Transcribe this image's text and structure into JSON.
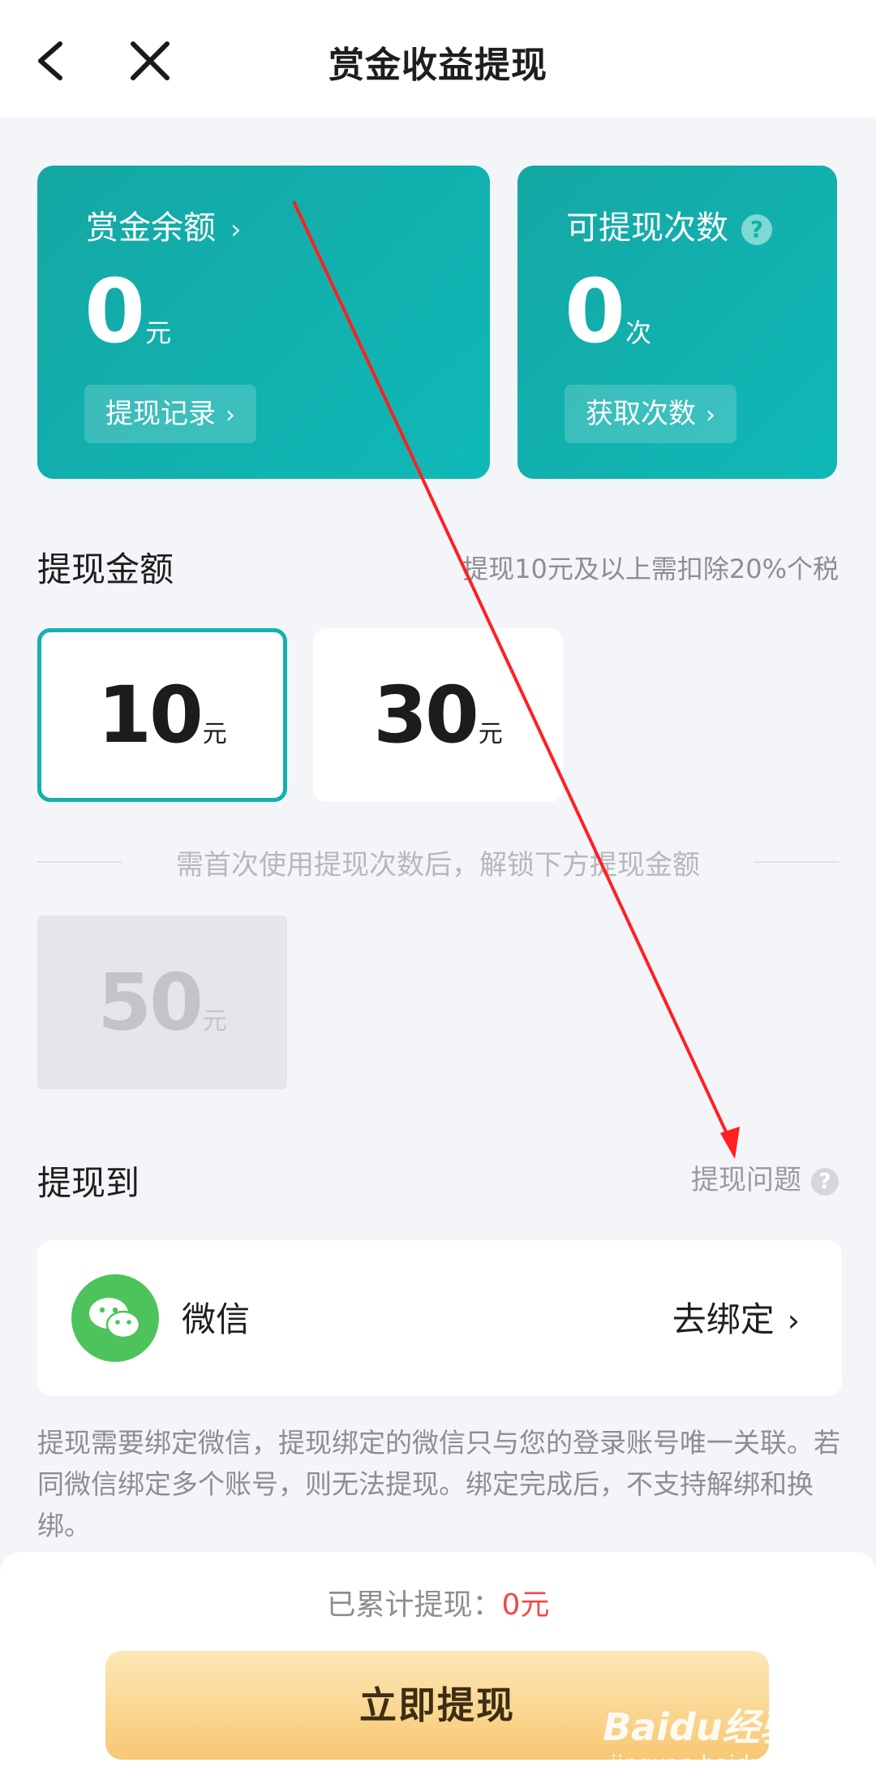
{
  "header": {
    "title": "赏金收益提现"
  },
  "balance_card": {
    "title": "赏金余额",
    "value": "0",
    "unit": "元",
    "button_label": "提现记录"
  },
  "count_card": {
    "title": "可提现次数",
    "help_glyph": "?",
    "value": "0",
    "unit": "次",
    "button_label": "获取次数"
  },
  "amount_section": {
    "title": "提现金额",
    "note": "提现10元及以上需扣除20%个税",
    "options": [
      {
        "value": "10",
        "unit": "元",
        "selected": true
      },
      {
        "value": "30",
        "unit": "元",
        "selected": false
      }
    ],
    "unlock_note": "需首次使用提现次数后，解锁下方提现金额",
    "locked_option": {
      "value": "50",
      "unit": "元"
    }
  },
  "withdraw_to": {
    "title": "提现到",
    "question_label": "提现问题",
    "method_name": "微信",
    "method_action": "去绑定"
  },
  "notice": "提现需要绑定微信，提现绑定的微信只与您的登录账号唯一关联。若同微信绑定多个账号，则无法提现。绑定完成后，不支持解绑和换绑。",
  "footer": {
    "total_label": "已累计提现：",
    "total_value": "0元",
    "submit_label": "立即提现"
  },
  "watermark": {
    "main": "Baidu经验",
    "sub": "jingyan.baidu.com"
  },
  "colors": {
    "card_teal": "#14a7a4",
    "selected_border": "#15b0ad",
    "wechat_green": "#4dc45b",
    "total_red": "#f04848",
    "button_gold": "#f8c873",
    "annotation_arrow": "#ff2020"
  },
  "icons": [
    "back-arrow-icon",
    "close-icon",
    "chevron-right-icon",
    "help-icon",
    "wechat-icon"
  ]
}
